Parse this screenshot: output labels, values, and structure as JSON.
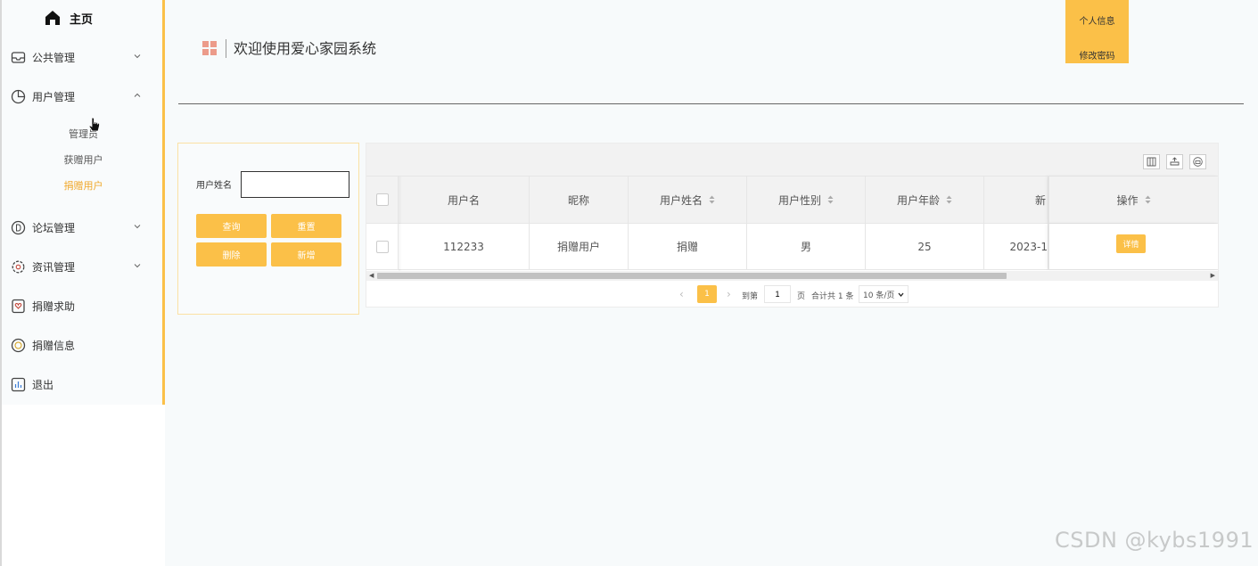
{
  "sidebar": {
    "home": "主页",
    "items": [
      {
        "label": "公共管理",
        "icon": "envelope-icon",
        "has_chevron": true,
        "expanded": false
      },
      {
        "label": "用户管理",
        "icon": "pie-chart-icon",
        "has_chevron": true,
        "expanded": true
      },
      {
        "label": "论坛管理",
        "icon": "circle-d-icon",
        "has_chevron": true,
        "expanded": false
      },
      {
        "label": "资讯管理",
        "icon": "gear-icon",
        "has_chevron": true,
        "expanded": false
      },
      {
        "label": "捐赠求助",
        "icon": "heart-badge-icon",
        "has_chevron": false
      },
      {
        "label": "捐赠信息",
        "icon": "coin-icon",
        "has_chevron": false
      },
      {
        "label": "退出",
        "icon": "bar-chart-icon",
        "has_chevron": false
      }
    ],
    "submenu": [
      {
        "label": "管理员",
        "active": false
      },
      {
        "label": "获赠用户",
        "active": false
      },
      {
        "label": "捐赠用户",
        "active": true
      }
    ]
  },
  "header": {
    "title": "欢迎使用爱心家园系统",
    "profile_label": "个人信息",
    "change_password_label": "修改密码"
  },
  "search": {
    "label": "用户姓名",
    "value": "",
    "buttons": {
      "query": "查询",
      "reset": "重置",
      "delete": "删除",
      "add": "新增"
    }
  },
  "table": {
    "columns": [
      "用户名",
      "昵称",
      "用户姓名",
      "用户性别",
      "用户年龄",
      "新",
      "操作"
    ],
    "sortable": [
      false,
      false,
      true,
      true,
      true,
      false,
      true
    ],
    "rows": [
      {
        "username": "112233",
        "nickname": "捐赠用户",
        "name": "捐赠",
        "gender": "男",
        "age": "25",
        "date": "2023-1",
        "action": "详情"
      }
    ]
  },
  "pager": {
    "current": "1",
    "goto_label": "到第",
    "goto_value": "1",
    "page_unit": "页",
    "total_label": "合计共 1 条",
    "page_size": "10 条/页"
  },
  "watermark": "CSDN @kybs1991",
  "colors": {
    "accent": "#fbc048",
    "active_text": "#f0a82a"
  }
}
